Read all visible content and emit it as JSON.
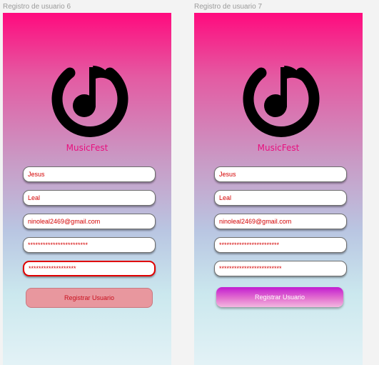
{
  "frames": [
    {
      "label": "Registro de usuario 6",
      "brand": "MusicFest",
      "fields": {
        "first_name": "Jesus",
        "last_name": "Leal",
        "email": "ninoleal2469@gmail.com",
        "password": "************************",
        "confirm_password": "*******************"
      },
      "button": {
        "label": "Registrar Usuario",
        "state": "disabled"
      }
    },
    {
      "label": "Registro de usuario 7",
      "brand": "MusicFest",
      "fields": {
        "first_name": "Jesus",
        "last_name": "Leal",
        "email": "ninoleal2469@gmail.com",
        "password": "************************",
        "confirm_password": "*************************"
      },
      "button": {
        "label": "Registrar Usuario",
        "state": "enabled"
      }
    }
  ],
  "icons": [
    "music-note-power-logo-icon"
  ],
  "colors": {
    "gradient_top": "#ff0a7e",
    "gradient_bottom": "#e3f2f6",
    "brand_text": "#e8107e",
    "field_text": "#d40000",
    "focus_border": "#e00000",
    "disabled_button": "#e8979e",
    "active_button": "#c21bd1"
  }
}
